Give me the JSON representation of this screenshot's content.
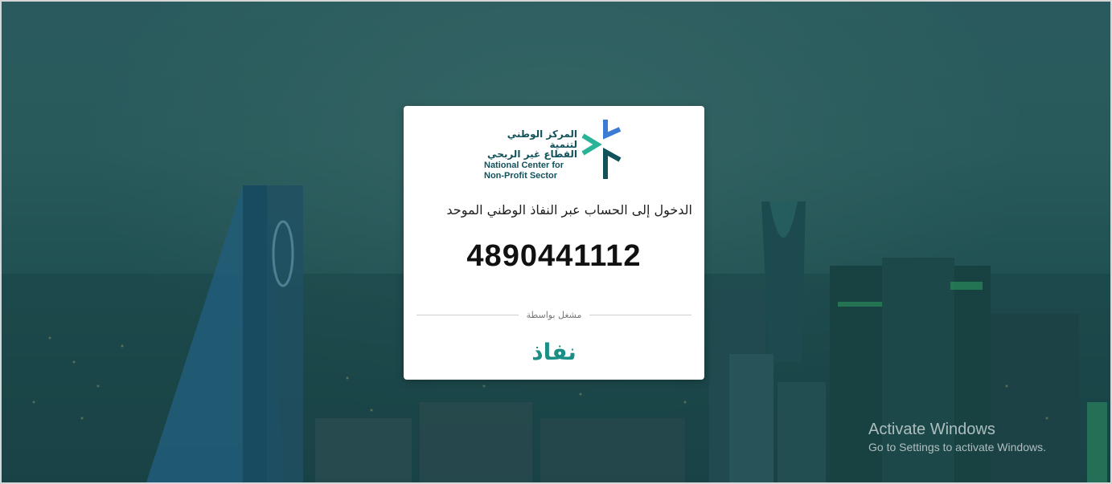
{
  "page": {
    "background_color": "#2f5a5e"
  },
  "card": {
    "logo": {
      "arabic_line1": "المركز الوطني لتنمية",
      "arabic_line2": "القطاع غير الربحي",
      "english_line1": "National Center for",
      "english_line2": "Non-Profit Sector",
      "brand_colors": [
        "#2bb39a",
        "#3b7bd4",
        "#12525b"
      ]
    },
    "title": "الدخول إلى الحساب عبر النفاذ الوطني الموحد",
    "verification_code": "4890441112",
    "operated_by_label": "مشغل بواسطة",
    "provider_name": "نفاذ",
    "provider_color": "#1a8f86"
  },
  "watermark": {
    "title": "Activate Windows",
    "subtitle": "Go to Settings to activate Windows."
  }
}
